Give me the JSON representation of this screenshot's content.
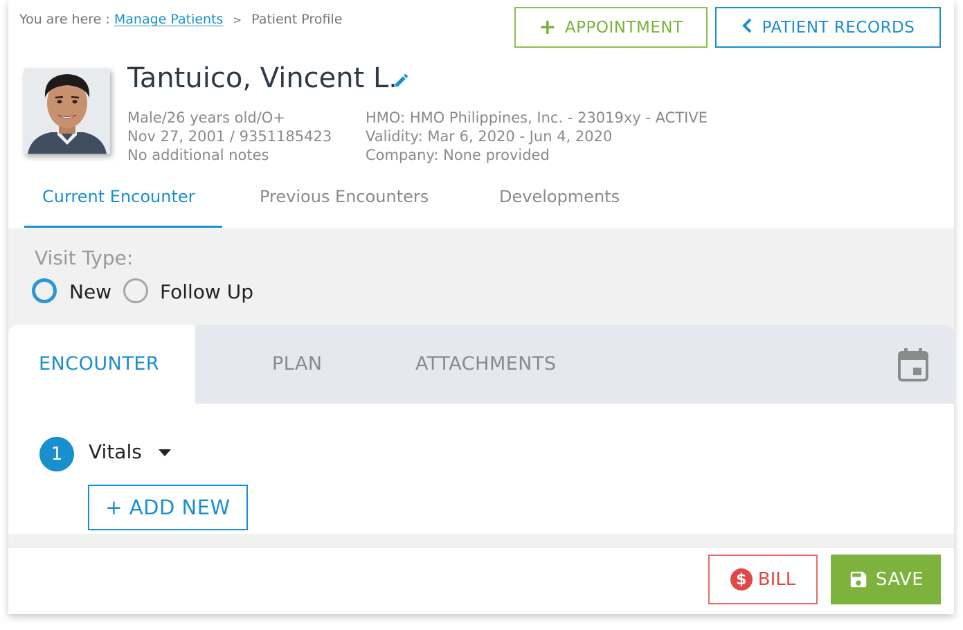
{
  "breadcrumb": {
    "prefix": "You are here :",
    "link": "Manage Patients",
    "separator": ">",
    "current": "Patient Profile"
  },
  "header_buttons": {
    "appointment": "APPOINTMENT",
    "patient_records": "PATIENT RECORDS"
  },
  "patient": {
    "name": "Tantuico, Vincent L.",
    "left_info": [
      "Male/26 years old/O+",
      "Nov 27, 2001 / 9351185423",
      "No additional notes"
    ],
    "right_info": [
      "HMO: HMO Philippines, Inc. - 23019xy - ACTIVE",
      "Validity: Mar 6, 2020 - Jun 4, 2020",
      "Company: None provided"
    ]
  },
  "tabs": [
    {
      "label": "Current Encounter",
      "active": true
    },
    {
      "label": "Previous Encounters",
      "active": false
    },
    {
      "label": "Developments",
      "active": false
    }
  ],
  "visit_type": {
    "label": "Visit Type:",
    "options": [
      "New",
      "Follow Up"
    ],
    "selected": "New"
  },
  "subtabs": [
    {
      "label": "ENCOUNTER",
      "active": true
    },
    {
      "label": "PLAN",
      "active": false
    },
    {
      "label": "ATTACHMENTS",
      "active": false
    }
  ],
  "section": {
    "step": "1",
    "label": "Vitals",
    "add_button": "+ ADD NEW"
  },
  "footer": {
    "bill": "BILL",
    "save": "SAVE"
  },
  "icons": {
    "appointment": "plus-icon",
    "records": "chevron-left-icon",
    "edit": "pencil-icon",
    "calendar": "calendar-icon",
    "caret": "caret-down-icon",
    "bill": "dollar-icon",
    "save": "floppy-disk-icon"
  },
  "colors": {
    "primary": "#1a8fce",
    "green": "#7db23c",
    "red": "#e04848",
    "text_dark": "#2d3a46",
    "text_muted": "#8a8a8a"
  }
}
